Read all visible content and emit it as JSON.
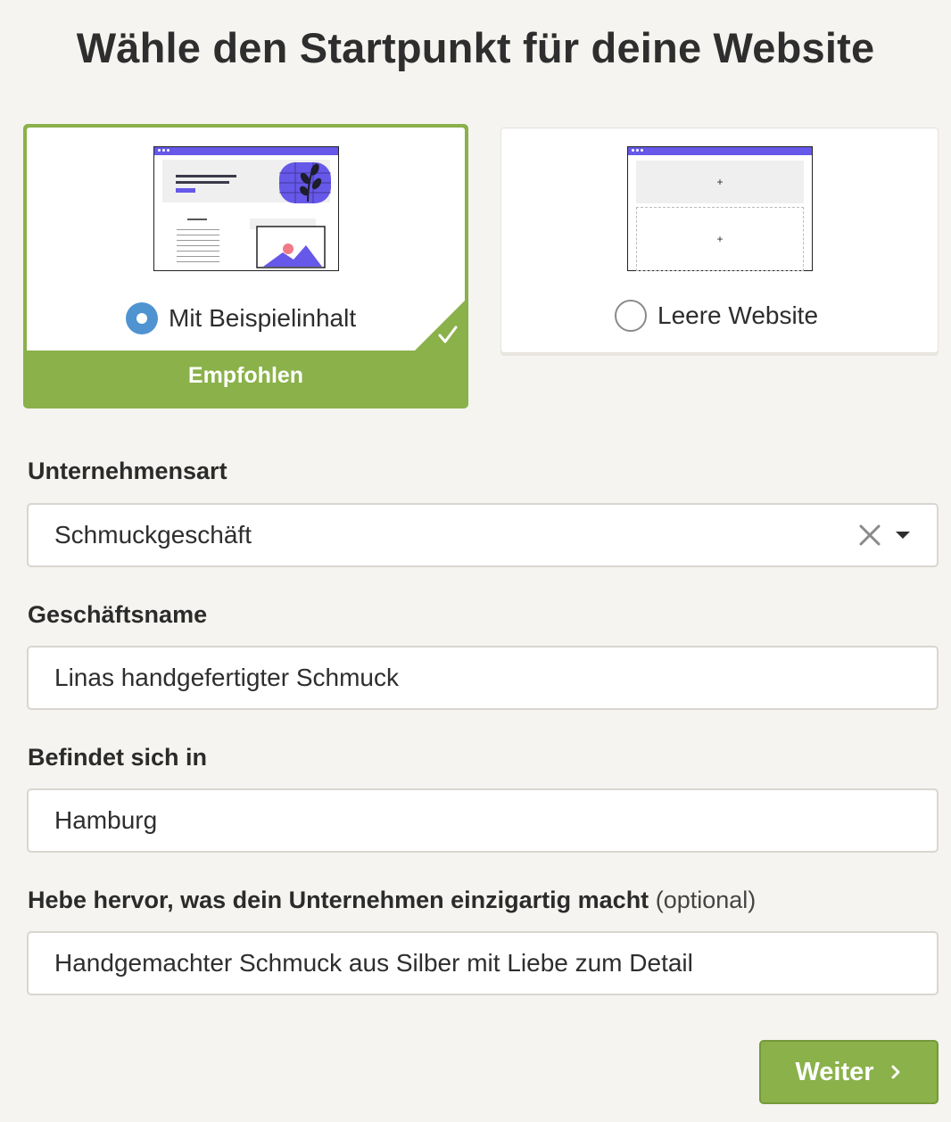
{
  "title": "Wähle den Startpunkt für deine Website",
  "options": [
    {
      "label": "Mit Beispielinhalt",
      "selected": true,
      "badge": "Empfohlen"
    },
    {
      "label": "Leere Website",
      "selected": false
    }
  ],
  "fields": {
    "business_type": {
      "label": "Unternehmensart",
      "value": "Schmuckgeschäft"
    },
    "business_name": {
      "label": "Geschäftsname",
      "value": "Linas handgefertigter Schmuck"
    },
    "location": {
      "label": "Befindet sich in",
      "value": "Hamburg"
    },
    "highlight": {
      "label": "Hebe hervor, was dein Unternehmen einzigartig macht",
      "optional": "(optional)",
      "value": "Handgemachter Schmuck aus Silber mit Liebe zum Detail"
    }
  },
  "thumb_plus": "+",
  "next_button": "Weiter",
  "colors": {
    "accent_green": "#8ab14a",
    "radio_blue": "#4f93d1",
    "thumb_purple": "#6658e8"
  },
  "icons": [
    "checkmark-icon",
    "radio-selected-icon",
    "radio-empty-icon",
    "clear-icon",
    "caret-down-icon",
    "chevron-right-icon"
  ]
}
